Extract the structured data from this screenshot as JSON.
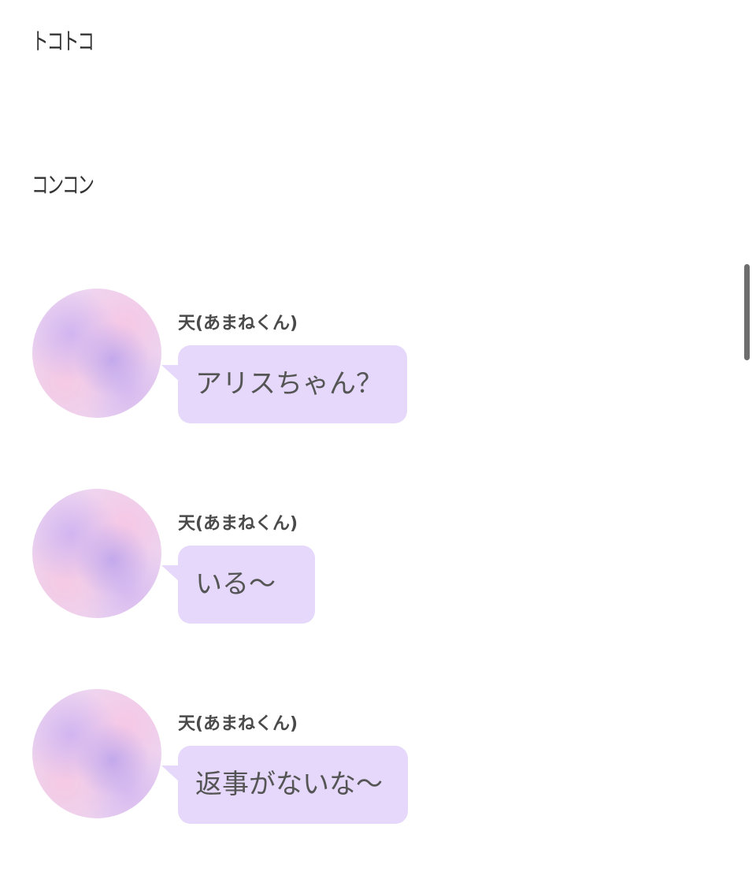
{
  "sound_effects": [
    "トコトコ",
    "コンコン"
  ],
  "messages": [
    {
      "sender": "天(あまねくん)",
      "text": "アリスちゃん？"
    },
    {
      "sender": "天(あまねくん)",
      "text": "いる〜"
    },
    {
      "sender": "天(あまねくん)",
      "text": "返事がないな〜"
    }
  ],
  "colors": {
    "bubble": "#e5d8fa",
    "avatar": "#ecd4f0",
    "scrollbar": "#6e6e6e"
  }
}
